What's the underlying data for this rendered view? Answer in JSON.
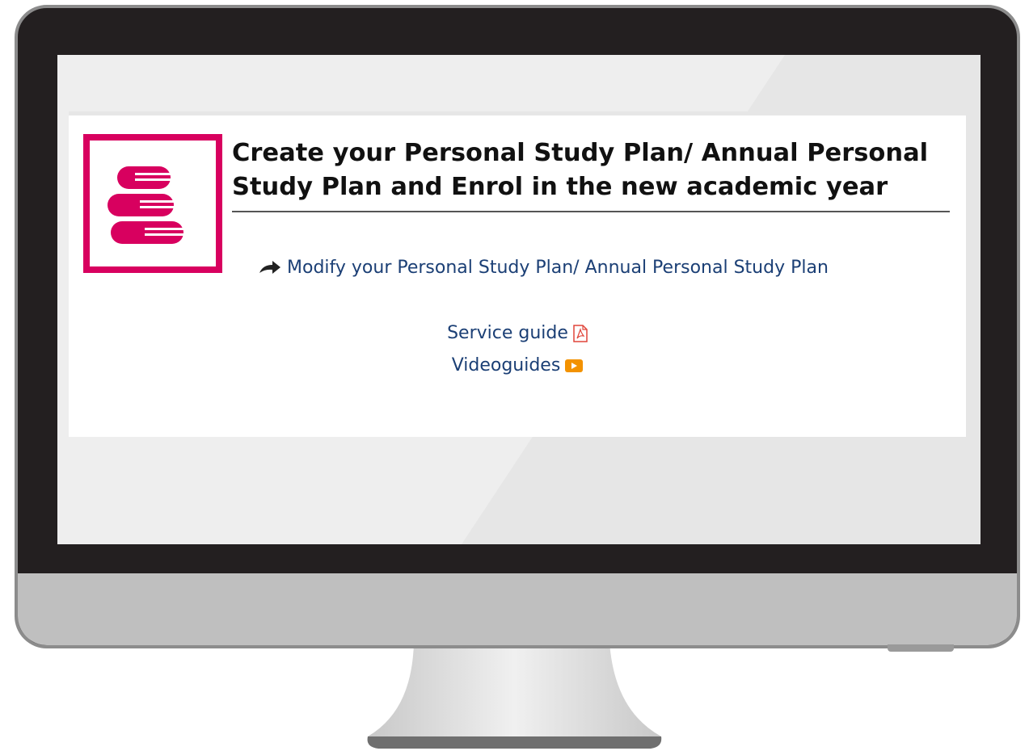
{
  "panel": {
    "title": "Create your Personal Study Plan/ Annual Personal Study Plan and Enrol in the new academic year",
    "logo_icon": "stacked-books-icon",
    "modify_link": {
      "icon": "share-arrow-icon",
      "label": "Modify your Personal Study Plan/ Annual Personal Study Plan"
    },
    "service_guide": {
      "label": "Service guide",
      "icon": "pdf-icon"
    },
    "videoguides": {
      "label": "Videoguides",
      "icon": "video-play-icon"
    }
  },
  "colors": {
    "brand_magenta": "#d8005f",
    "link_blue": "#1b3f75",
    "pdf_red": "#e0453a",
    "video_orange": "#f39200",
    "bezel": "#231f20",
    "chin": "#bfbfbf"
  }
}
